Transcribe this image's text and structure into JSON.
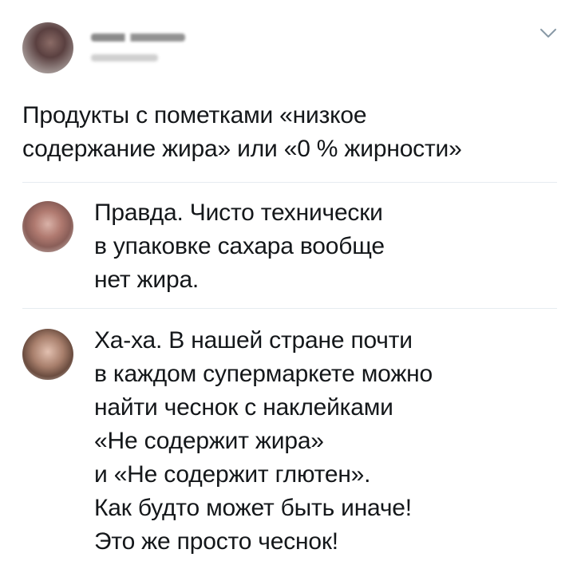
{
  "tweet": {
    "author_name_blurred": "",
    "author_handle_blurred": "",
    "menu_icon": "chevron-down-icon",
    "text_lines": [
      "Продукты с пометками «низкое",
      "содержание жира» или «0 % жирности»"
    ]
  },
  "replies": [
    {
      "avatar": "avatar",
      "text_lines": [
        "Правда. Чисто технически",
        "в упаковке сахара вообще",
        "нет жира."
      ]
    },
    {
      "avatar": "avatar",
      "text_lines": [
        "Ха-ха. В нашей стране почти",
        "в каждом супермаркете можно",
        "найти чеснок с наклейками",
        "«Не содержит жира»",
        "и «Не содержит глютен».",
        "Как будто может быть иначе!",
        "Это же просто чеснок!"
      ]
    }
  ],
  "colors": {
    "text": "#14171a",
    "divider": "#e6ecf0",
    "chevron": "#8899a6",
    "background": "#ffffff"
  }
}
